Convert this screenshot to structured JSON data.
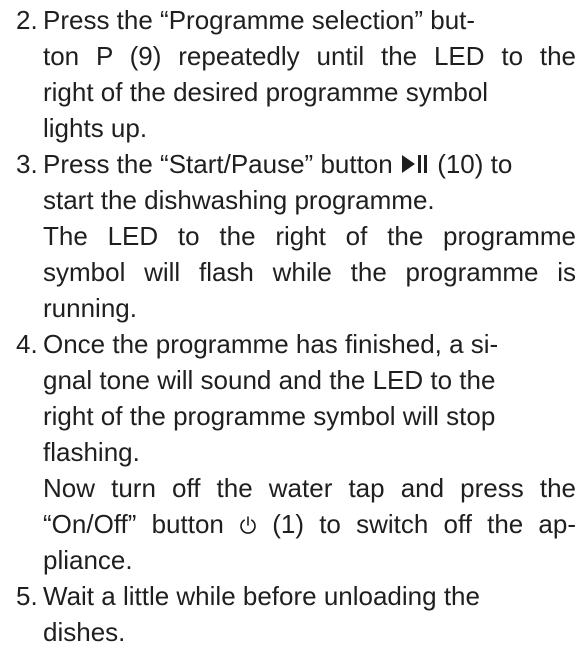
{
  "steps": [
    {
      "number": "2.",
      "lines": [
        "Press the “Programme selection” but-",
        "ton P (9) repeatedly until the LED to the",
        "right of the desired programme symbol",
        "lights up."
      ]
    },
    {
      "number": "3.",
      "line1_before": "Press the “Start/Pause” button ",
      "line1_after": " (10) to",
      "lines": [
        "start the dishwashing programme.",
        "The LED to the right of the programme",
        "symbol will flash while the programme is",
        "running."
      ]
    },
    {
      "number": "4.",
      "lines": [
        "Once the programme has finished, a si-",
        "gnal tone will sound and the LED to the",
        "right of the programme symbol will stop",
        "flashing.",
        "Now turn off the water tap and press the"
      ],
      "line6_before": "“On/Off” button ",
      "line6_after": " (1) to switch off the ap-",
      "line7": "pliance."
    },
    {
      "number": "5.",
      "lines": [
        "Wait a little while before unloading the",
        "dishes."
      ]
    }
  ],
  "icons": {
    "start_pause": "play-pause-icon",
    "power": "power-icon"
  }
}
